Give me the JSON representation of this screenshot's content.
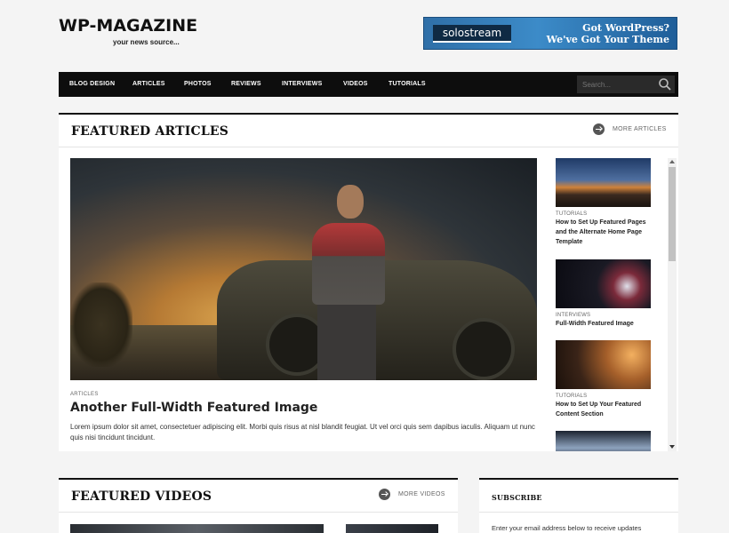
{
  "site": {
    "title": "WP-MAGAZINE",
    "tagline": "your news source..."
  },
  "banner": {
    "logo": "solostream",
    "line1": "Got WordPress?",
    "line2": "We've Got Your Theme"
  },
  "nav": {
    "items": [
      "BLOG DESIGN",
      "ARTICLES",
      "PHOTOS",
      "REVIEWS",
      "INTERVIEWS",
      "VIDEOS",
      "TUTORIALS"
    ]
  },
  "search": {
    "placeholder": "Search..."
  },
  "featured_articles": {
    "title": "FEATURED ARTICLES",
    "more_label": "MORE ARTICLES",
    "hero": {
      "category": "ARTICLES",
      "title": "Another Full-Width Featured Image",
      "excerpt": "Lorem ipsum dolor sit amet, consectetuer adipiscing elit. Morbi quis risus at nisl blandit feugiat. Ut vel orci quis sem dapibus iaculis. Aliquam ut nunc quis nisi tincidunt tincidunt."
    },
    "side_items": [
      {
        "category": "TUTORIALS",
        "title": "How to Set Up Featured Pages and the Alternate Home Page Template"
      },
      {
        "category": "INTERVIEWS",
        "title": "Full-Width Featured Image"
      },
      {
        "category": "TUTORIALS",
        "title": "How to Set Up Your Featured Content Section"
      }
    ]
  },
  "featured_videos": {
    "title": "FEATURED VIDEOS",
    "more_label": "MORE VIDEOS"
  },
  "subscribe": {
    "title": "SUBSCRIBE",
    "text": "Enter your email address below to receive updates"
  },
  "colors": {
    "nav_bg": "#0d0d0d",
    "banner_blue": "#3c8bc8",
    "page_bg": "#f4f4f4"
  }
}
